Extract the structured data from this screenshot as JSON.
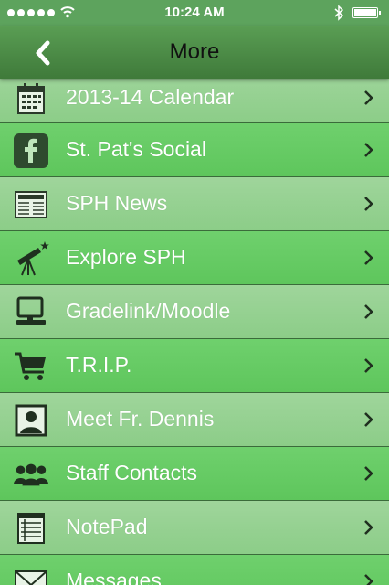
{
  "status_bar": {
    "time": "10:24 AM"
  },
  "nav": {
    "title": "More"
  },
  "menu": [
    {
      "label": "2013-14 Calendar",
      "icon": "calendar-icon"
    },
    {
      "label": "St. Pat's Social",
      "icon": "facebook-icon"
    },
    {
      "label": "SPH News",
      "icon": "newspaper-icon"
    },
    {
      "label": "Explore SPH",
      "icon": "telescope-icon"
    },
    {
      "label": "Gradelink/Moodle",
      "icon": "computer-icon"
    },
    {
      "label": "T.R.I.P.",
      "icon": "shopping-cart-icon"
    },
    {
      "label": "Meet Fr. Dennis",
      "icon": "portrait-icon"
    },
    {
      "label": "Staff Contacts",
      "icon": "people-icon"
    },
    {
      "label": "NotePad",
      "icon": "notepad-icon"
    },
    {
      "label": "Messages",
      "icon": "envelope-icon"
    }
  ]
}
